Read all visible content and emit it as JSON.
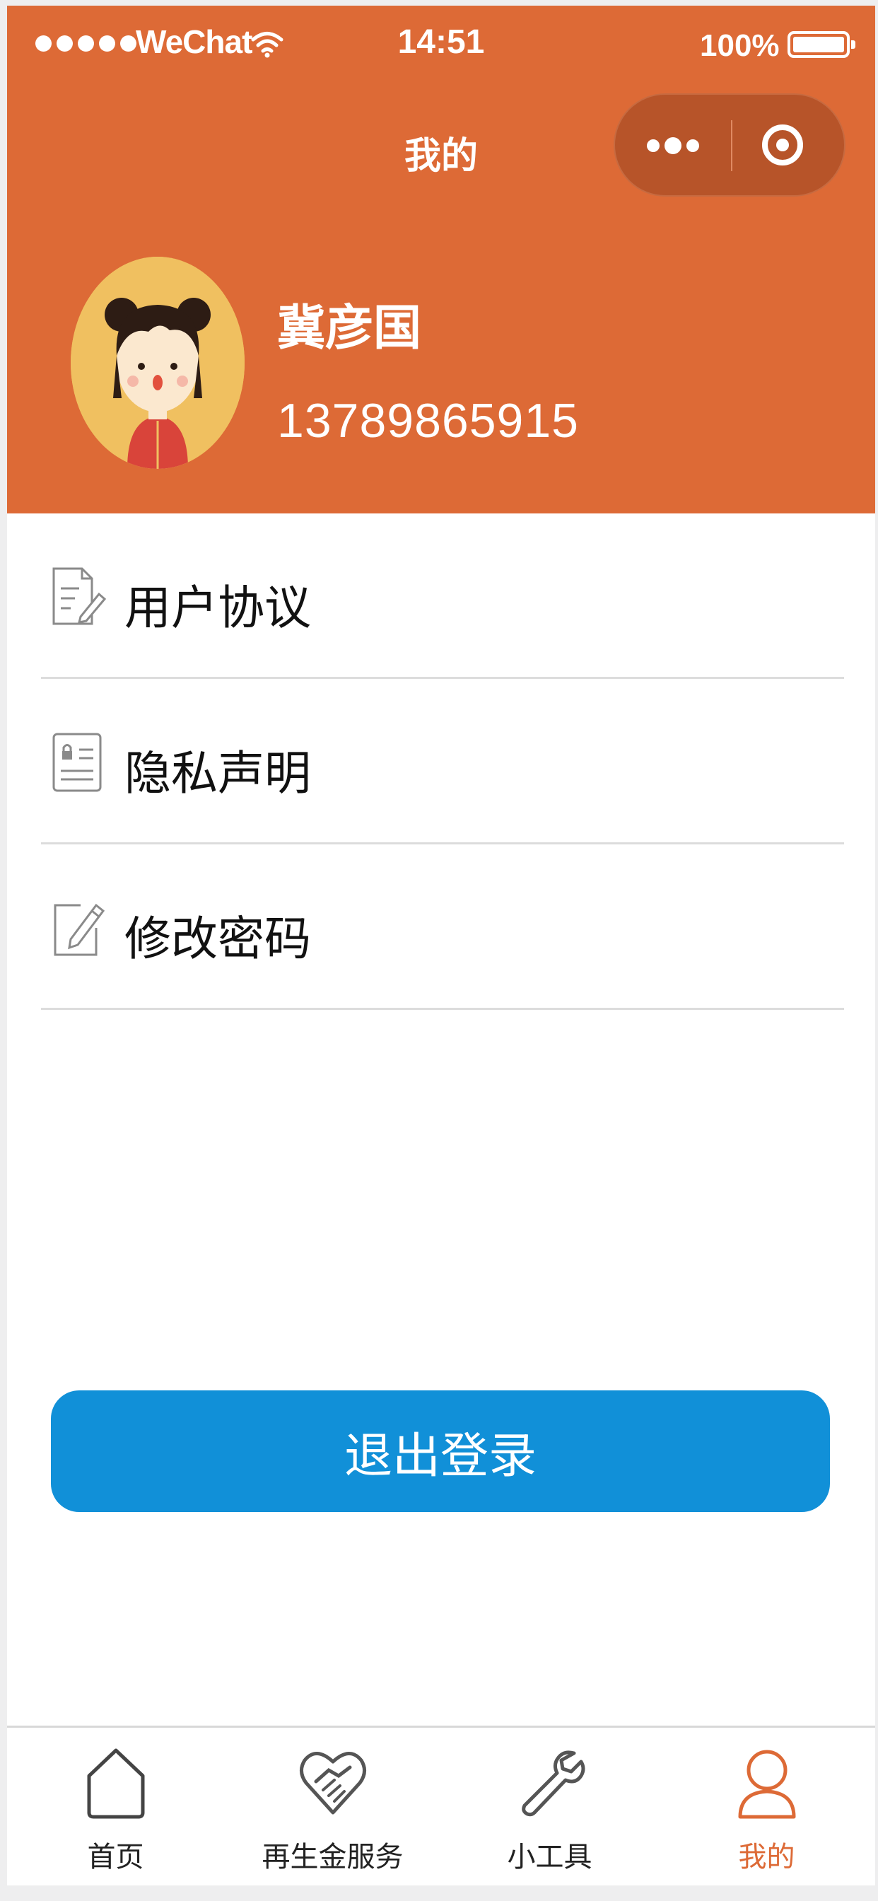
{
  "status_bar": {
    "carrier": "WeChat",
    "time": "14:51",
    "battery": "100%"
  },
  "nav": {
    "title": "我的"
  },
  "user": {
    "name": "冀彦国",
    "phone": "13789865915"
  },
  "menu": [
    {
      "label": "用户协议",
      "icon": "document-edit-icon"
    },
    {
      "label": "隐私声明",
      "icon": "privacy-card-icon"
    },
    {
      "label": "修改密码",
      "icon": "pencil-edit-icon"
    }
  ],
  "logout": {
    "label": "退出登录"
  },
  "tabbar": [
    {
      "label": "首页",
      "icon": "home-icon"
    },
    {
      "label": "再生金服务",
      "icon": "heart-handshake-icon"
    },
    {
      "label": "小工具",
      "icon": "wrench-icon"
    },
    {
      "label": "我的",
      "icon": "user-icon",
      "active": true
    }
  ],
  "colors": {
    "brand": "#dd6a36",
    "button": "#1190d8",
    "active_tab": "#dd6a36"
  }
}
